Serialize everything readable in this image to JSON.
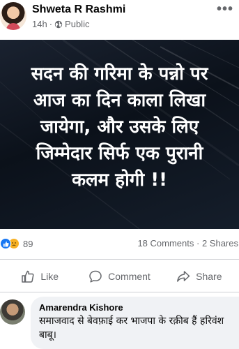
{
  "post": {
    "author": "Shweta R Rashmi",
    "time": "14h",
    "separator": "·",
    "privacy": "Public",
    "more_label": "•••",
    "image_text_lines": [
      "सदन की गरिमा के पन्नो पर",
      "आज का दिन काला लिखा",
      "जायेगा, और उसके लिए",
      "जिम्मेदार सिर्फ एक पुरानी",
      "कलम होगी !!"
    ]
  },
  "stats": {
    "reaction_count": "89",
    "comments": "18 Comments",
    "dot": "·",
    "shares": "2 Shares"
  },
  "actions": {
    "like": "Like",
    "comment": "Comment",
    "share": "Share"
  },
  "comment": {
    "author": "Amarendra Kishore",
    "text": "समाजवाद से बेवफ़ाई कर भाजपा के रक़ीब हैं हरिवंश बाबू।"
  },
  "icons": {
    "globe": "globe-icon",
    "more": "more-icon",
    "like_reaction": "like-reaction-icon",
    "sad_reaction": "sad-reaction-icon",
    "like": "thumbs-up-icon",
    "comment": "comment-bubble-icon",
    "share": "share-arrow-icon"
  },
  "colors": {
    "accent": "#1877f2",
    "sad": "#f7b125",
    "muted_text": "#65676b",
    "image_bg": "#0b111a",
    "bubble_bg": "#f0f2f5"
  }
}
